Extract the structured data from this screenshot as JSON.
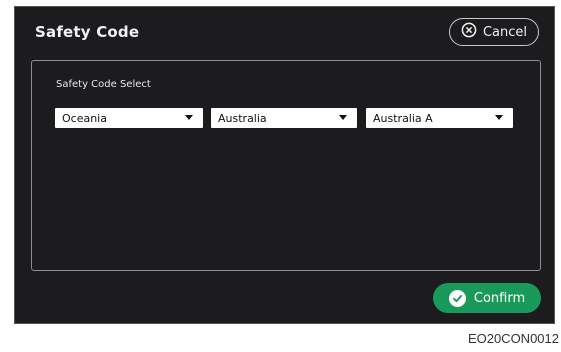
{
  "dialog": {
    "title": "Safety Code",
    "cancel_label": "Cancel",
    "confirm_label": "Confirm"
  },
  "panel": {
    "label": "Safety Code  Select",
    "selects": [
      {
        "value": "Oceania"
      },
      {
        "value": "Australia"
      },
      {
        "value": "Australia A"
      }
    ]
  },
  "caption": "EO20CON0012",
  "colors": {
    "background": "#1c1c1e",
    "confirm": "#1a9a5a",
    "text": "#f2f2f2"
  }
}
